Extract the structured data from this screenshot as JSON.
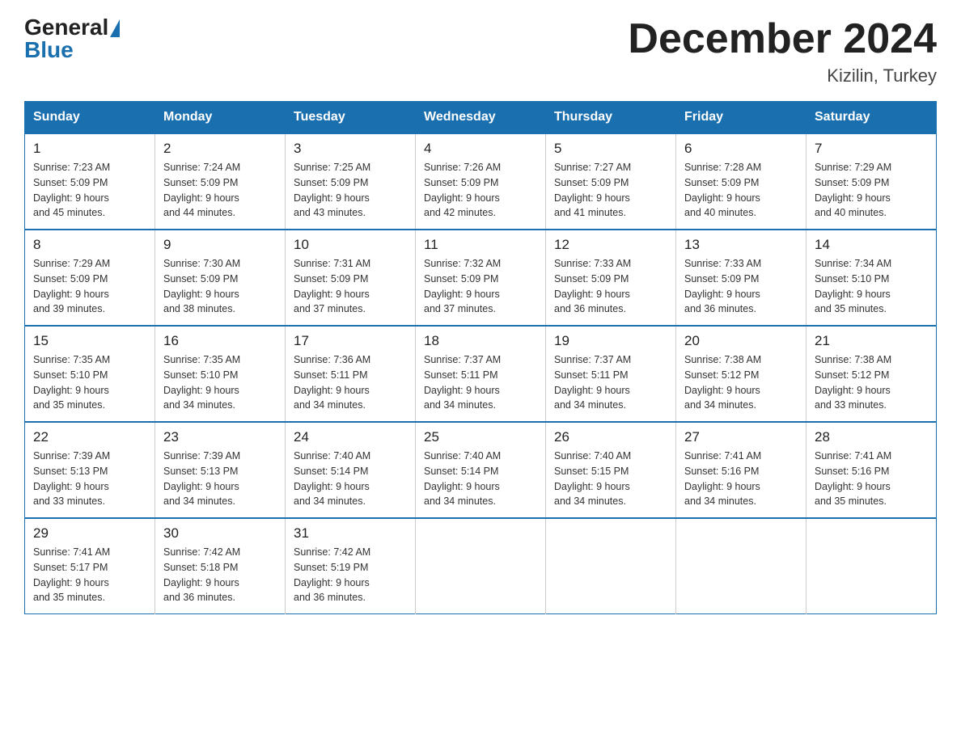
{
  "logo": {
    "general": "General",
    "blue": "Blue"
  },
  "title": "December 2024",
  "subtitle": "Kizilin, Turkey",
  "days_of_week": [
    "Sunday",
    "Monday",
    "Tuesday",
    "Wednesday",
    "Thursday",
    "Friday",
    "Saturday"
  ],
  "weeks": [
    [
      {
        "day": "1",
        "sunrise": "7:23 AM",
        "sunset": "5:09 PM",
        "daylight": "9 hours and 45 minutes."
      },
      {
        "day": "2",
        "sunrise": "7:24 AM",
        "sunset": "5:09 PM",
        "daylight": "9 hours and 44 minutes."
      },
      {
        "day": "3",
        "sunrise": "7:25 AM",
        "sunset": "5:09 PM",
        "daylight": "9 hours and 43 minutes."
      },
      {
        "day": "4",
        "sunrise": "7:26 AM",
        "sunset": "5:09 PM",
        "daylight": "9 hours and 42 minutes."
      },
      {
        "day": "5",
        "sunrise": "7:27 AM",
        "sunset": "5:09 PM",
        "daylight": "9 hours and 41 minutes."
      },
      {
        "day": "6",
        "sunrise": "7:28 AM",
        "sunset": "5:09 PM",
        "daylight": "9 hours and 40 minutes."
      },
      {
        "day": "7",
        "sunrise": "7:29 AM",
        "sunset": "5:09 PM",
        "daylight": "9 hours and 40 minutes."
      }
    ],
    [
      {
        "day": "8",
        "sunrise": "7:29 AM",
        "sunset": "5:09 PM",
        "daylight": "9 hours and 39 minutes."
      },
      {
        "day": "9",
        "sunrise": "7:30 AM",
        "sunset": "5:09 PM",
        "daylight": "9 hours and 38 minutes."
      },
      {
        "day": "10",
        "sunrise": "7:31 AM",
        "sunset": "5:09 PM",
        "daylight": "9 hours and 37 minutes."
      },
      {
        "day": "11",
        "sunrise": "7:32 AM",
        "sunset": "5:09 PM",
        "daylight": "9 hours and 37 minutes."
      },
      {
        "day": "12",
        "sunrise": "7:33 AM",
        "sunset": "5:09 PM",
        "daylight": "9 hours and 36 minutes."
      },
      {
        "day": "13",
        "sunrise": "7:33 AM",
        "sunset": "5:09 PM",
        "daylight": "9 hours and 36 minutes."
      },
      {
        "day": "14",
        "sunrise": "7:34 AM",
        "sunset": "5:10 PM",
        "daylight": "9 hours and 35 minutes."
      }
    ],
    [
      {
        "day": "15",
        "sunrise": "7:35 AM",
        "sunset": "5:10 PM",
        "daylight": "9 hours and 35 minutes."
      },
      {
        "day": "16",
        "sunrise": "7:35 AM",
        "sunset": "5:10 PM",
        "daylight": "9 hours and 34 minutes."
      },
      {
        "day": "17",
        "sunrise": "7:36 AM",
        "sunset": "5:11 PM",
        "daylight": "9 hours and 34 minutes."
      },
      {
        "day": "18",
        "sunrise": "7:37 AM",
        "sunset": "5:11 PM",
        "daylight": "9 hours and 34 minutes."
      },
      {
        "day": "19",
        "sunrise": "7:37 AM",
        "sunset": "5:11 PM",
        "daylight": "9 hours and 34 minutes."
      },
      {
        "day": "20",
        "sunrise": "7:38 AM",
        "sunset": "5:12 PM",
        "daylight": "9 hours and 34 minutes."
      },
      {
        "day": "21",
        "sunrise": "7:38 AM",
        "sunset": "5:12 PM",
        "daylight": "9 hours and 33 minutes."
      }
    ],
    [
      {
        "day": "22",
        "sunrise": "7:39 AM",
        "sunset": "5:13 PM",
        "daylight": "9 hours and 33 minutes."
      },
      {
        "day": "23",
        "sunrise": "7:39 AM",
        "sunset": "5:13 PM",
        "daylight": "9 hours and 34 minutes."
      },
      {
        "day": "24",
        "sunrise": "7:40 AM",
        "sunset": "5:14 PM",
        "daylight": "9 hours and 34 minutes."
      },
      {
        "day": "25",
        "sunrise": "7:40 AM",
        "sunset": "5:14 PM",
        "daylight": "9 hours and 34 minutes."
      },
      {
        "day": "26",
        "sunrise": "7:40 AM",
        "sunset": "5:15 PM",
        "daylight": "9 hours and 34 minutes."
      },
      {
        "day": "27",
        "sunrise": "7:41 AM",
        "sunset": "5:16 PM",
        "daylight": "9 hours and 34 minutes."
      },
      {
        "day": "28",
        "sunrise": "7:41 AM",
        "sunset": "5:16 PM",
        "daylight": "9 hours and 35 minutes."
      }
    ],
    [
      {
        "day": "29",
        "sunrise": "7:41 AM",
        "sunset": "5:17 PM",
        "daylight": "9 hours and 35 minutes."
      },
      {
        "day": "30",
        "sunrise": "7:42 AM",
        "sunset": "5:18 PM",
        "daylight": "9 hours and 36 minutes."
      },
      {
        "day": "31",
        "sunrise": "7:42 AM",
        "sunset": "5:19 PM",
        "daylight": "9 hours and 36 minutes."
      },
      null,
      null,
      null,
      null
    ]
  ],
  "labels": {
    "sunrise": "Sunrise:",
    "sunset": "Sunset:",
    "daylight": "Daylight:"
  }
}
